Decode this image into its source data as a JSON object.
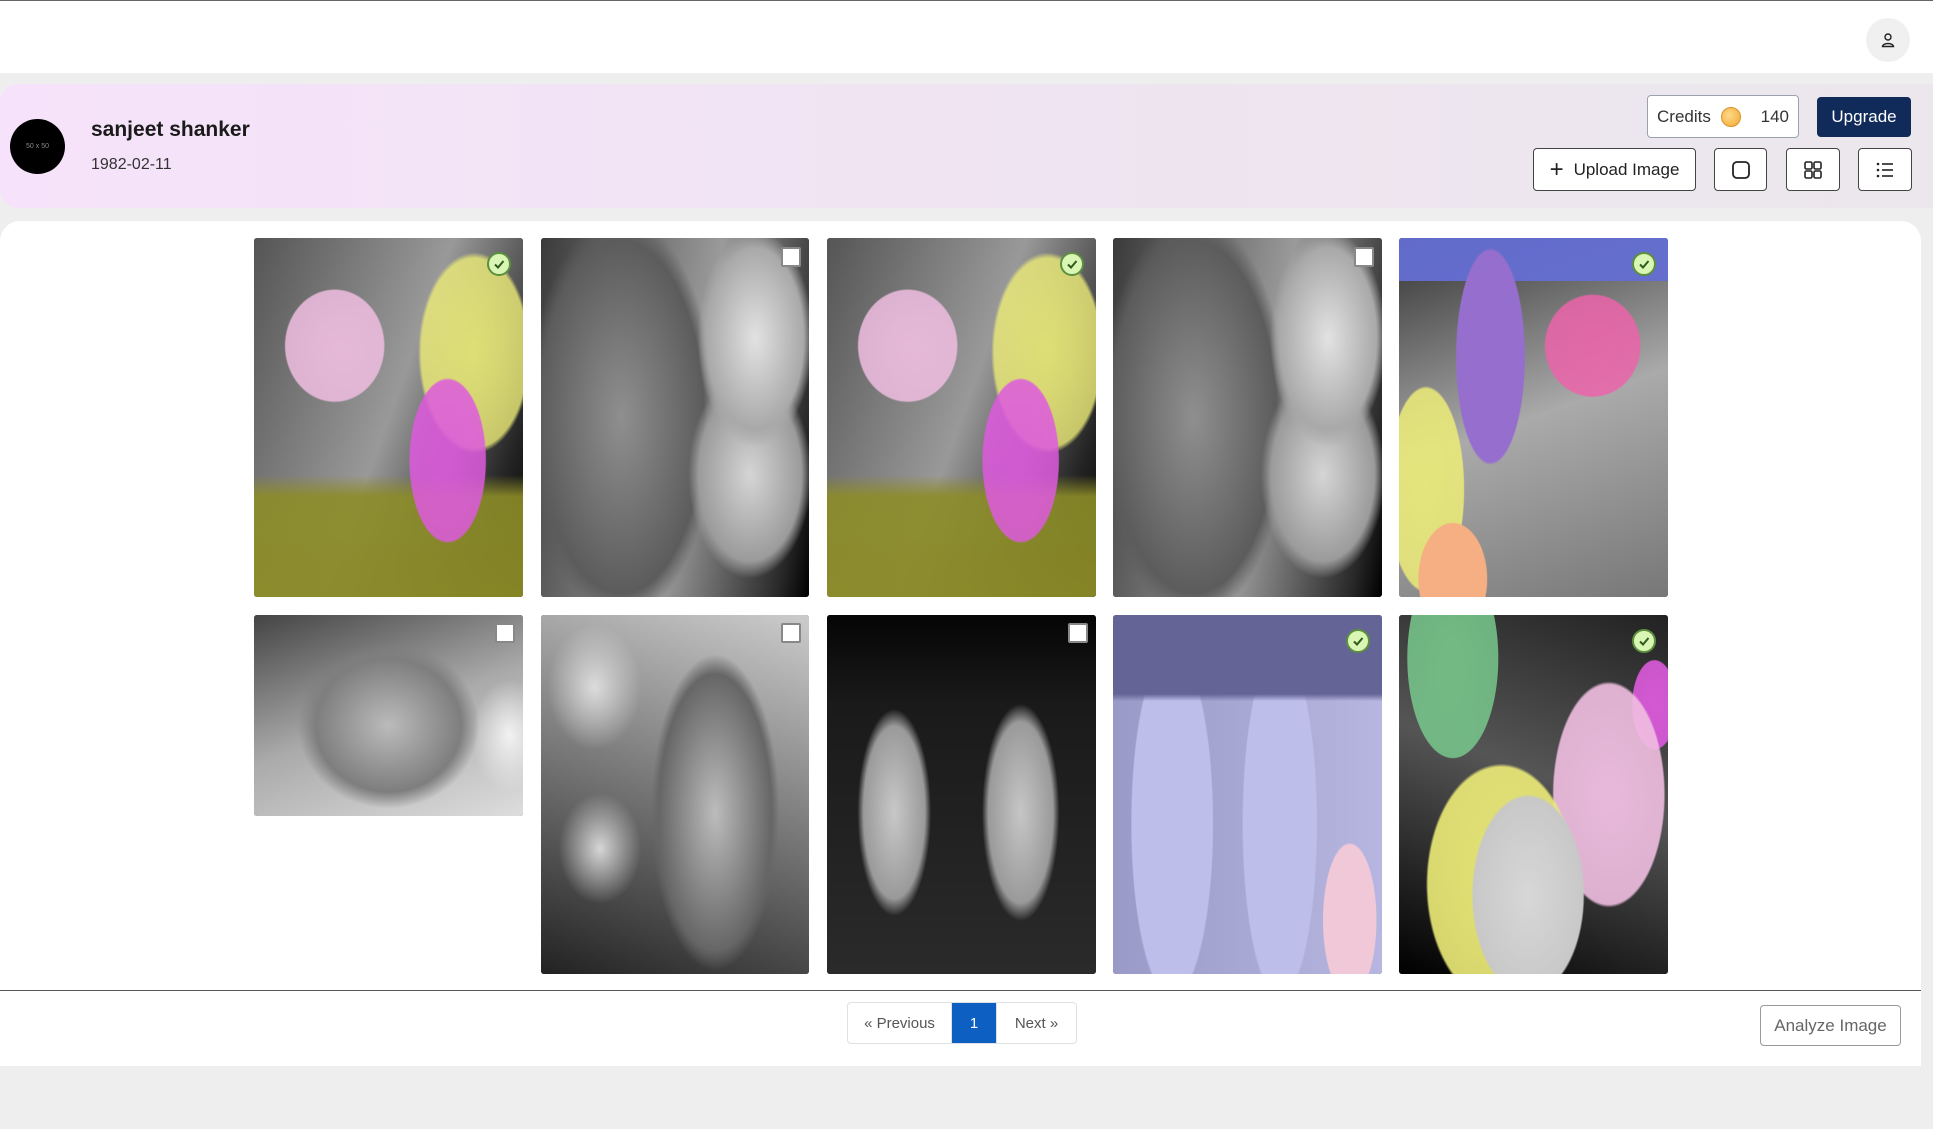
{
  "header": {
    "user_icon": "user-icon"
  },
  "patient": {
    "avatar_text": "50 x 50",
    "name": "sanjeet shanker",
    "dob": "1982-02-11"
  },
  "credits": {
    "label": "Credits",
    "icon": "coin-icon",
    "value": "140"
  },
  "upgrade_label": "Upgrade",
  "toolbar": {
    "upload_label": "Upload Image",
    "view_single_icon": "square-icon",
    "view_grid_icon": "grid-icon",
    "view_list_icon": "list-icon"
  },
  "images": [
    {
      "type": "segmented",
      "selected": true
    },
    {
      "type": "xray",
      "selected": false
    },
    {
      "type": "segmented",
      "selected": true
    },
    {
      "type": "xray",
      "selected": false
    },
    {
      "type": "segmented",
      "selected": true
    },
    {
      "type": "xray",
      "selected": false
    },
    {
      "type": "xray",
      "selected": false
    },
    {
      "type": "xray",
      "selected": false
    },
    {
      "type": "segmented",
      "selected": true
    },
    {
      "type": "segmented",
      "selected": true
    }
  ],
  "pagination": {
    "prev_label": "« Previous",
    "current_page": "1",
    "next_label": "Next »"
  },
  "analyze_label": "Analyze Image",
  "colors": {
    "primary": "#102a5a",
    "page_active": "#0d5fc2",
    "check_bg": "#d9f6b4",
    "check_border": "#5c8f3e"
  }
}
